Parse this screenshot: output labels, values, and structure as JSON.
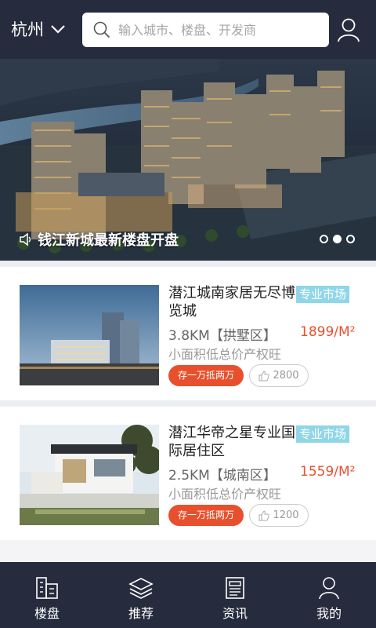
{
  "header": {
    "city": "杭州",
    "search_placeholder": "输入城市、楼盘、开发商"
  },
  "banner": {
    "caption": "钱江新城最新楼盘开盘",
    "slide_count": 3,
    "active_slide": 2
  },
  "listings": [
    {
      "title": "潜江城南家居无尽博览城",
      "tag": "专业市场",
      "distance": "3.8KM【拱墅区】",
      "price": "1899/M²",
      "desc": "小面积低总价产权旺",
      "promo": "存一万抵两万",
      "likes": "2800"
    },
    {
      "title": "潜江华帝之星专业国际居住区",
      "tag": "专业市场",
      "distance": "2.5KM【城南区】",
      "price": "1559/M²",
      "desc": "小面积低总价产权旺",
      "promo": "存一万抵两万",
      "likes": "1200"
    }
  ],
  "tabbar": {
    "items": [
      {
        "label": "楼盘",
        "icon": "building-icon"
      },
      {
        "label": "推荐",
        "icon": "layers-icon"
      },
      {
        "label": "资讯",
        "icon": "news-icon"
      },
      {
        "label": "我的",
        "icon": "person-icon"
      }
    ]
  },
  "colors": {
    "header_bg": "#262b3d",
    "accent": "#e8502d",
    "tag_bg": "#8fd6e8"
  }
}
